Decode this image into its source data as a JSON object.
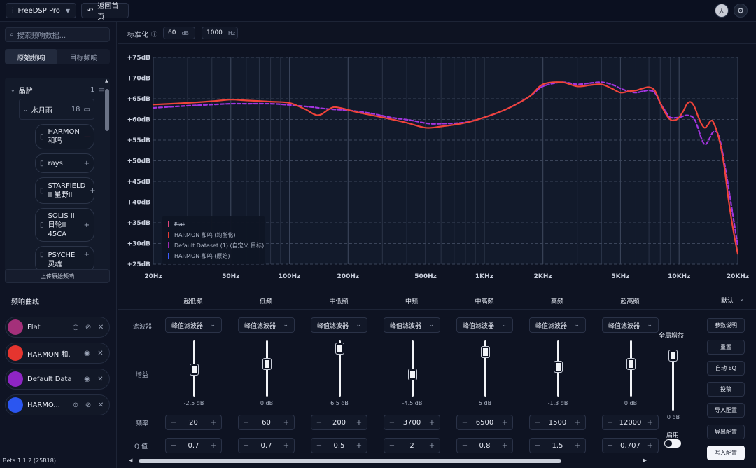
{
  "topbar": {
    "app_label": "FreeDSP Pro",
    "back_label": "返回首页",
    "avatar_initial": "人"
  },
  "sidebar": {
    "search_placeholder": "搜索频响数据...",
    "tabs": [
      {
        "label": "原始频响",
        "active": true
      },
      {
        "label": "目标频响",
        "active": false
      }
    ],
    "tree": {
      "root_label": "品牌",
      "root_count": "1",
      "brand_label": "水月雨",
      "brand_count": "18",
      "items": [
        {
          "label_line1": "HARMON",
          "label_line2": "和鸣",
          "action": "—"
        },
        {
          "label_line1": "rays",
          "label_line2": "",
          "action": "+"
        },
        {
          "label_line1": "STARFIELD",
          "label_line2": "II 星野II",
          "action": "+"
        },
        {
          "label_line1": "SOLIS II",
          "label_line2": "日轮II",
          "label_line3": "45CA",
          "action": "+"
        },
        {
          "label_line1": "PSYCHE",
          "label_line2": "灵魂",
          "action": "+"
        }
      ]
    },
    "upload_label": "上传原始频响"
  },
  "normalize": {
    "label": "标准化",
    "db_value": "60",
    "db_unit": "dB",
    "hz_value": "1000",
    "hz_unit": "Hz"
  },
  "chart_data": {
    "type": "line",
    "x_scale": "log",
    "xlim": [
      20,
      20000
    ],
    "ylim": [
      25,
      75
    ],
    "x_ticks": [
      "20Hz",
      "50Hz",
      "100Hz",
      "200Hz",
      "500Hz",
      "1KHz",
      "2KHz",
      "5KHz",
      "10KHz",
      "20KHz"
    ],
    "x_tick_values": [
      20,
      50,
      100,
      200,
      500,
      1000,
      2000,
      5000,
      10000,
      20000
    ],
    "y_ticks": [
      "+25dB",
      "+30dB",
      "+35dB",
      "+40dB",
      "+45dB",
      "+50dB",
      "+55dB",
      "+60dB",
      "+65dB",
      "+70dB",
      "+75dB"
    ],
    "y_tick_values": [
      25,
      30,
      35,
      40,
      45,
      50,
      55,
      60,
      65,
      70,
      75
    ],
    "grid": true,
    "legend_position": "bottom-left",
    "legend": [
      {
        "label": "Flat",
        "color": "#e0457b",
        "strike": true
      },
      {
        "label": "HARMON 和鸣 (均衡化)",
        "color": "#e53935",
        "strike": false
      },
      {
        "label": "Default Dataset (1) (自定义 目标)",
        "color": "#9c27b0",
        "strike": false
      },
      {
        "label": "HARMON 和鸣 (原始)",
        "color": "#3d5afe",
        "strike": true
      }
    ],
    "series": [
      {
        "name": "HARMON 和鸣 (均衡化)",
        "color": "#f0443a",
        "style": "solid",
        "x": [
          20,
          30,
          40,
          50,
          60,
          80,
          100,
          120,
          140,
          160,
          170,
          190,
          220,
          300,
          400,
          500,
          600,
          800,
          1000,
          1300,
          1700,
          2000,
          2500,
          3000,
          3500,
          4000,
          4500,
          5000,
          5500,
          6000,
          6500,
          7000,
          7500,
          8000,
          8500,
          9000,
          9500,
          10000,
          10500,
          11000,
          11500,
          12000,
          12500,
          13000,
          13500,
          14000,
          14500,
          15000,
          16000,
          17000,
          18000,
          19000,
          20000
        ],
        "y": [
          63.6,
          64.0,
          64.4,
          64.8,
          64.6,
          64.3,
          64.0,
          62.5,
          61.0,
          62.5,
          63.0,
          62.6,
          61.8,
          60.5,
          59.2,
          58.0,
          58.3,
          59.2,
          60.5,
          62.5,
          65.5,
          68.5,
          69.0,
          68.0,
          68.3,
          68.5,
          67.5,
          66.5,
          66.8,
          67.0,
          67.5,
          67.8,
          67.0,
          64.0,
          61.5,
          60.0,
          59.8,
          60.5,
          62.0,
          63.8,
          64.2,
          63.0,
          60.8,
          59.0,
          58.0,
          58.6,
          59.6,
          59.3,
          55.5,
          49.0,
          40.0,
          33.0,
          27.5
        ]
      },
      {
        "name": "Default Dataset (1) (自定义 目标)",
        "color": "#a335e0",
        "style": "dashed",
        "x": [
          20,
          30,
          40,
          50,
          60,
          80,
          100,
          130,
          160,
          200,
          260,
          330,
          420,
          520,
          620,
          800,
          1000,
          1300,
          1700,
          2000,
          2500,
          3000,
          3500,
          4000,
          4500,
          5000,
          5500,
          6000,
          6500,
          7000,
          7500,
          8000,
          8500,
          9000,
          10000,
          11000,
          12000,
          13000,
          13500,
          14000,
          15000,
          16000,
          17000,
          18000,
          19000,
          20000
        ],
        "y": [
          62.8,
          63.3,
          63.6,
          63.8,
          63.8,
          63.8,
          63.5,
          63.0,
          62.5,
          62.2,
          61.5,
          60.5,
          59.8,
          59.0,
          59.0,
          59.3,
          60.5,
          62.5,
          65.5,
          68.0,
          69.0,
          68.5,
          68.8,
          69.0,
          68.5,
          67.5,
          66.8,
          66.5,
          66.8,
          67.0,
          66.5,
          64.0,
          62.0,
          60.5,
          60.5,
          61.0,
          60.0,
          55.5,
          54.0,
          54.5,
          57.0,
          56.0,
          50.0,
          43.0,
          36.0,
          29.5
        ]
      }
    ]
  },
  "bottom": {
    "curves_title": "频响曲线",
    "curves": [
      {
        "name": "Flat",
        "color": "#a4307a",
        "first_icon": "circle-icon"
      },
      {
        "name": "HARMON 和...",
        "color": "#e5352f",
        "first_icon": "eye-icon"
      },
      {
        "name": "Default Data...",
        "color": "#8e25c4",
        "first_icon": "eye-icon"
      },
      {
        "name": "HARMO...",
        "color": "#2b56f0",
        "first_icon": "check-circle-icon"
      }
    ],
    "version": "Beta 1.1.2 (25B18)",
    "bands": [
      {
        "head": "超低频",
        "filter": "峰值滤波器",
        "gain": "-2.5  dB",
        "gain_db": -2.5,
        "freq": "20",
        "q": "0.7"
      },
      {
        "head": "低频",
        "filter": "峰值滤波器",
        "gain": "0 dB",
        "gain_db": 0,
        "freq": "60",
        "q": "0.7"
      },
      {
        "head": "中低频",
        "filter": "峰值滤波器",
        "gain": "6.5 dB",
        "gain_db": 6.5,
        "freq": "200",
        "q": "0.5"
      },
      {
        "head": "中频",
        "filter": "峰值滤波器",
        "gain": "-4.5  dB",
        "gain_db": -4.5,
        "freq": "3700",
        "q": "2"
      },
      {
        "head": "中高频",
        "filter": "峰值滤波器",
        "gain": "5 dB",
        "gain_db": 5,
        "freq": "6500",
        "q": "0.8"
      },
      {
        "head": "高频",
        "filter": "峰值滤波器",
        "gain": "-1.3  dB",
        "gain_db": -1.3,
        "freq": "1500",
        "q": "1.5"
      },
      {
        "head": "超高频",
        "filter": "峰值滤波器",
        "gain": "0 dB",
        "gain_db": 0,
        "freq": "12000",
        "q": "0.707"
      }
    ],
    "row_labels": {
      "filter": "滤波器",
      "gain": "增益",
      "freq": "频率",
      "q": "Q 值"
    },
    "global_gain_label": "全局增益",
    "global_gain_value": "0 dB",
    "global_gain_db": 0,
    "enable_label": "启用",
    "enabled": true,
    "preset_label": "默认",
    "buttons": [
      "参数说明",
      "重置",
      "自动 EQ",
      "投稿",
      "导入配置",
      "导出配置",
      "写入配置"
    ]
  }
}
